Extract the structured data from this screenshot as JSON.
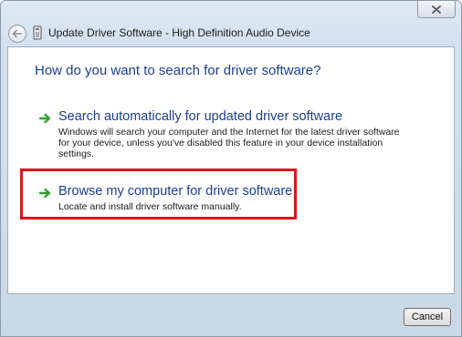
{
  "window": {
    "title": "Update Driver Software - High Definition Audio Device"
  },
  "icons": {
    "back": "back-arrow-icon",
    "device": "device-icon",
    "close": "close-icon",
    "option_arrow": "green-arrow-icon"
  },
  "colors": {
    "heading": "#1c3f94",
    "arrow": "#2fa52d",
    "highlight": "#e0151d"
  },
  "main": {
    "heading": "How do you want to search for driver software?",
    "options": [
      {
        "title": "Search automatically for updated driver software",
        "description": "Windows will search your computer and the Internet for the latest driver software for your device, unless you've disabled this feature in your device installation settings."
      },
      {
        "title": "Browse my computer for driver software",
        "description": "Locate and install driver software manually."
      }
    ]
  },
  "footer": {
    "cancel_label": "Cancel"
  }
}
